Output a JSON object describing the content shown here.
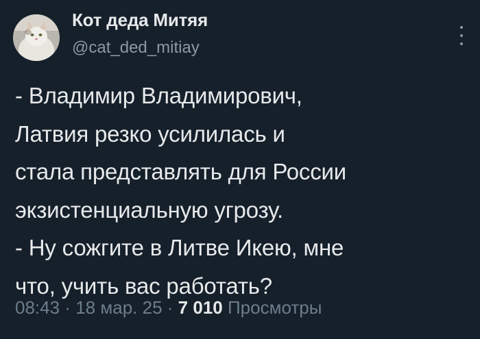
{
  "author": {
    "display_name": "Кот деда Митяя",
    "handle": "@cat_ded_mitiay",
    "avatar": "cat-avatar"
  },
  "menu_icon": "more-vertical-icon",
  "tweet": {
    "lines": [
      "- Владимир Владимирович,",
      "Латвия резко усилилась и",
      "стала представлять для России",
      "экзистенциальную угрозу.",
      "- Ну сожгите в Литве Икею, мне",
      "что, учить вас работать?"
    ]
  },
  "meta": {
    "time": "08:43",
    "separator": "·",
    "date": "18 мар. 25",
    "views_count": "7 010",
    "views_label": "Просмотры"
  },
  "colors": {
    "background": "#15202b",
    "text": "#e7e9ea",
    "secondary": "#8b98a5"
  }
}
